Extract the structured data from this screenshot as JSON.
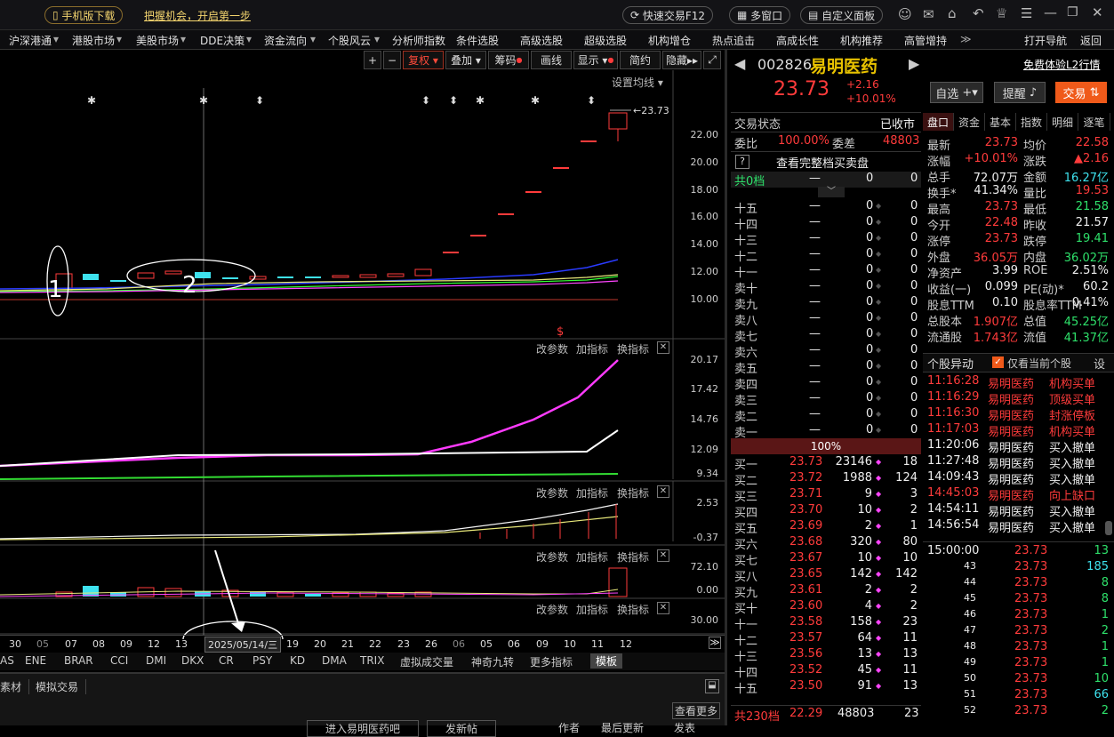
{
  "topbar": {
    "mobile": "手机版下载",
    "slogan": "把握机会，开启第一步",
    "quick": "快速交易F12",
    "multi": "多窗口",
    "custom": "自定义面板"
  },
  "menu": [
    "沪深港通",
    "港股市场",
    "美股市场",
    "DDE决策",
    "资金流向",
    "个股风云",
    "分析师指数",
    "条件选股",
    "高级选股",
    "超级选股",
    "机构增仓",
    "热点追击",
    "高成长性",
    "机构推荐",
    "高管增持",
    "打开导航",
    "返回"
  ],
  "toolbar": {
    "plus": "+",
    "minus": "−",
    "fuquan": "复权",
    "overlay": "叠加",
    "chip": "筹码",
    "draw": "画线",
    "show": "显示",
    "simple": "简约",
    "hide": "隐藏"
  },
  "kline": {
    "ma_setting": "设置均线",
    "price_tag": "23.73",
    "yaxis": [
      "22.00",
      "20.00",
      "18.00",
      "16.00",
      "14.00",
      "12.00",
      "10.00"
    ],
    "ann1": "1",
    "ann2": "2",
    "s_mark": "$"
  },
  "sub": {
    "param": "改参数",
    "add": "加指标",
    "switch": "换指标",
    "p1": [
      "20.17",
      "17.42",
      "14.76",
      "12.09",
      "9.34"
    ],
    "p2": [
      "2.53",
      "-0.37"
    ],
    "p3": [
      "72.10",
      "0.00"
    ],
    "p4": [
      "30.00"
    ]
  },
  "xaxis": [
    "30",
    "05",
    "07",
    "08",
    "09",
    "12",
    "13",
    "2025/05/14/三",
    "19",
    "20",
    "21",
    "22",
    "23",
    "26",
    "06",
    "05",
    "06",
    "09",
    "10",
    "11",
    "12"
  ],
  "indicators": [
    "AS",
    "ENE",
    "BRAR",
    "CCI",
    "DMI",
    "DKX",
    "CR",
    "PSY",
    "KD",
    "DMA",
    "TRIX",
    "虚拟成交量",
    "神奇九转",
    "更多指标",
    "模板"
  ],
  "bottom": {
    "material": "素材",
    "sim": "模拟交易",
    "more": "查看更多",
    "f1": "进入易明医药吧",
    "f2": "发新帖",
    "f3": "作者",
    "f4": "最后更新",
    "f5": "发表"
  },
  "quote": {
    "code": "002826",
    "name": "易明医药",
    "price": "23.73",
    "chg": "+2.16",
    "pct": "+10.01%",
    "l2": "免费体验L2行情",
    "zixuan": "自选",
    "remind": "提醒",
    "trade": "交易"
  },
  "state": {
    "label": "交易状态",
    "value": "已收市",
    "wb_l": "委比",
    "wb": "100.00%",
    "wc_l": "委差",
    "wc": "48803",
    "full": "查看完整档买卖盘",
    "tot0": "共0档"
  },
  "sells": [
    [
      "十五",
      "—",
      "0"
    ],
    [
      "十四",
      "—",
      "0"
    ],
    [
      "十三",
      "—",
      "0"
    ],
    [
      "十二",
      "—",
      "0"
    ],
    [
      "十一",
      "—",
      "0"
    ],
    [
      "卖十",
      "—",
      "0"
    ],
    [
      "卖九",
      "—",
      "0"
    ],
    [
      "卖八",
      "—",
      "0"
    ],
    [
      "卖七",
      "—",
      "0"
    ],
    [
      "卖六",
      "—",
      "0"
    ],
    [
      "卖五",
      "—",
      "0"
    ],
    [
      "卖四",
      "—",
      "0"
    ],
    [
      "卖三",
      "—",
      "0"
    ],
    [
      "卖二",
      "—",
      "0"
    ],
    [
      "卖一",
      "—",
      "0"
    ]
  ],
  "ratio": "100%",
  "buys": [
    [
      "买一",
      "23.73",
      "23146",
      "18"
    ],
    [
      "买二",
      "23.72",
      "1988",
      "124"
    ],
    [
      "买三",
      "23.71",
      "9",
      "3"
    ],
    [
      "买四",
      "23.70",
      "10",
      "2"
    ],
    [
      "买五",
      "23.69",
      "2",
      "1"
    ],
    [
      "买六",
      "23.68",
      "320",
      "80"
    ],
    [
      "买七",
      "23.67",
      "10",
      "10"
    ],
    [
      "买八",
      "23.65",
      "142",
      "142"
    ],
    [
      "买九",
      "23.61",
      "2",
      "2"
    ],
    [
      "买十",
      "23.60",
      "4",
      "2"
    ],
    [
      "十一",
      "23.58",
      "158",
      "23"
    ],
    [
      "十二",
      "23.57",
      "64",
      "11"
    ],
    [
      "十三",
      "23.56",
      "13",
      "13"
    ],
    [
      "十四",
      "23.52",
      "45",
      "11"
    ],
    [
      "十五",
      "23.50",
      "91",
      "13"
    ]
  ],
  "buy_total": [
    "共230档",
    "22.29",
    "48803",
    "23"
  ],
  "tabs": [
    "盘口",
    "资金",
    "基本",
    "指数",
    "明细",
    "逐笔"
  ],
  "stats": [
    [
      "最新",
      "23.73",
      "均价",
      "22.58"
    ],
    [
      "涨幅",
      "+10.01%",
      "涨跌",
      "▲2.16"
    ],
    [
      "总手",
      "72.07万",
      "金额",
      "16.27亿"
    ],
    [
      "换手*",
      "41.34%",
      "量比",
      "19.53"
    ],
    [
      "最高",
      "23.73",
      "最低",
      "21.58"
    ],
    [
      "今开",
      "22.48",
      "昨收",
      "21.57"
    ],
    [
      "涨停",
      "23.73",
      "跌停",
      "19.41"
    ],
    [
      "外盘",
      "36.05万",
      "内盘",
      "36.02万"
    ],
    [
      "净资产",
      "3.99",
      "ROE",
      "2.51%"
    ],
    [
      "收益(一)",
      "0.099",
      "PE(动)*",
      "60.2"
    ],
    [
      "股息TTM",
      "0.10",
      "股息率TTM",
      "0.41%"
    ],
    [
      "总股本",
      "1.907亿",
      "总值",
      "45.25亿"
    ],
    [
      "流通股",
      "1.743亿",
      "流值",
      "41.37亿"
    ]
  ],
  "yd": {
    "title": "个股异动",
    "only": "仅看当前个股",
    "set": "设"
  },
  "events": [
    [
      "11:16:28",
      "易明医药",
      "机构买单"
    ],
    [
      "11:16:29",
      "易明医药",
      "顶级买单"
    ],
    [
      "11:16:30",
      "易明医药",
      "封涨停板"
    ],
    [
      "11:17:03",
      "易明医药",
      "机构买单"
    ],
    [
      "11:20:06",
      "易明医药",
      "买入撤单"
    ],
    [
      "11:27:48",
      "易明医药",
      "买入撤单"
    ],
    [
      "14:09:43",
      "易明医药",
      "买入撤单"
    ],
    [
      "14:45:03",
      "易明医药",
      "向上缺口"
    ],
    [
      "14:54:11",
      "易明医药",
      "买入撤单"
    ],
    [
      "14:56:54",
      "易明医药",
      "买入撤单"
    ]
  ],
  "ticks": [
    [
      "15:00:00",
      "23.73",
      "13"
    ],
    [
      "43",
      "23.73",
      "185"
    ],
    [
      "44",
      "23.73",
      "8"
    ],
    [
      "45",
      "23.73",
      "8"
    ],
    [
      "46",
      "23.73",
      "1"
    ],
    [
      "47",
      "23.73",
      "2"
    ],
    [
      "48",
      "23.73",
      "1"
    ],
    [
      "49",
      "23.73",
      "1"
    ],
    [
      "50",
      "23.73",
      "10"
    ],
    [
      "51",
      "23.73",
      "66"
    ],
    [
      "52",
      "23.73",
      "2"
    ]
  ],
  "colors": {
    "up": "#ff3b3b",
    "down": "#2ee06a",
    "cyan": "#3ee2ee",
    "accent": "#f05a1a"
  }
}
